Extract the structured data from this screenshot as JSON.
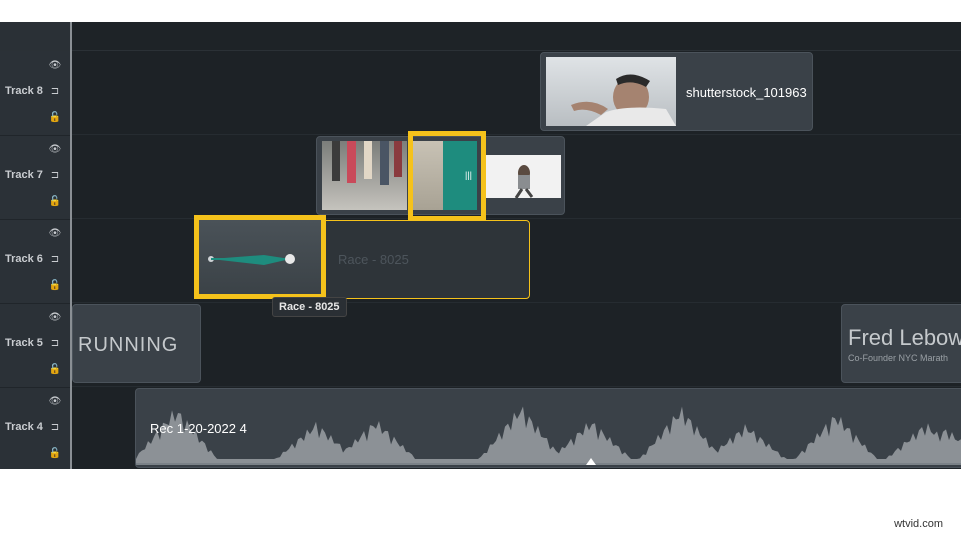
{
  "tracks": [
    {
      "label": "Track 8"
    },
    {
      "label": "Track 7"
    },
    {
      "label": "Track 6"
    },
    {
      "label": "Track 5"
    },
    {
      "label": "Track 4"
    }
  ],
  "clips": {
    "shutterstock": "shutterstock_101963",
    "race_ghost": "Race - 8025",
    "running": "RUNNING",
    "fred_name": "Fred Lebow",
    "fred_sub": "Co-Founder NYC Marath",
    "audio": "Rec 1-20-2022 4"
  },
  "tooltip": "Race - 8025",
  "watermark": "wtvid.com",
  "colors": {
    "accent": "#f5c21b",
    "transition": "#1e8c7e",
    "clip": "#3a4148"
  }
}
